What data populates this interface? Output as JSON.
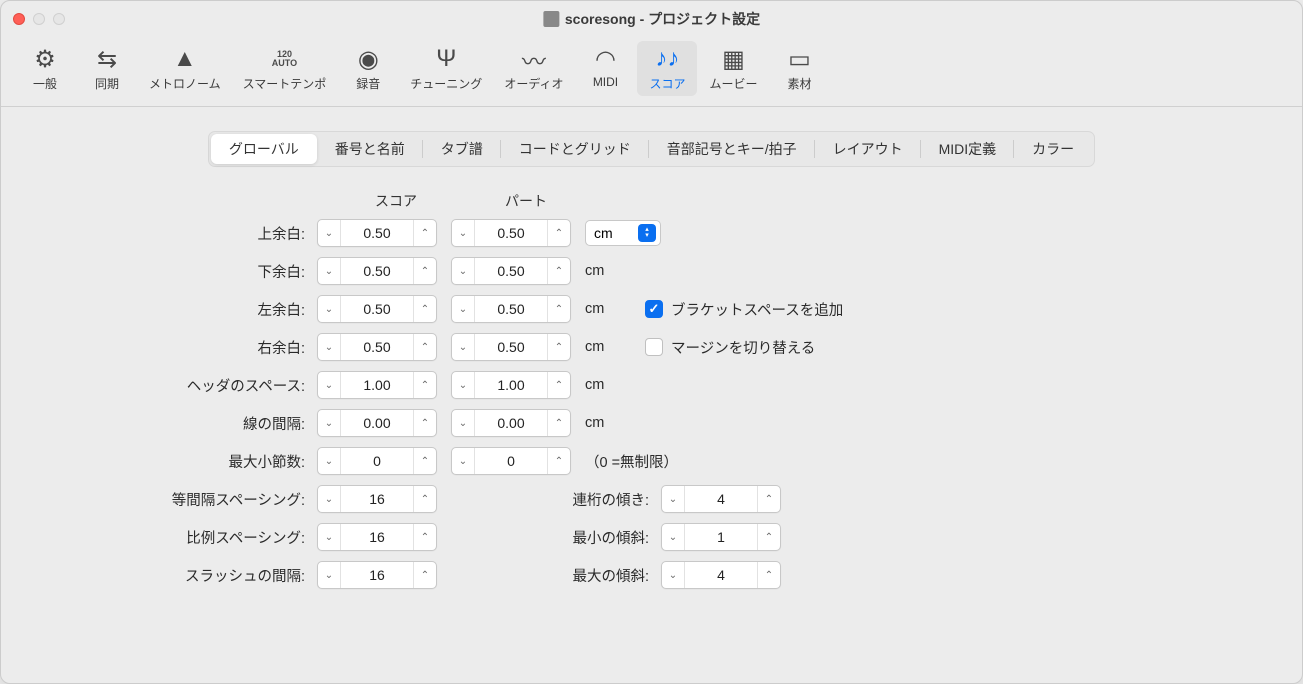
{
  "window": {
    "title": "scoresong - プロジェクト設定"
  },
  "toolbar": [
    {
      "id": "general",
      "label": "一般"
    },
    {
      "id": "sync",
      "label": "同期"
    },
    {
      "id": "metronome",
      "label": "メトロノーム"
    },
    {
      "id": "smarttempo",
      "label": "スマートテンポ"
    },
    {
      "id": "record",
      "label": "録音"
    },
    {
      "id": "tuning",
      "label": "チューニング"
    },
    {
      "id": "audio",
      "label": "オーディオ"
    },
    {
      "id": "midi",
      "label": "MIDI"
    },
    {
      "id": "score",
      "label": "スコア",
      "selected": true
    },
    {
      "id": "movie",
      "label": "ムービー"
    },
    {
      "id": "assets",
      "label": "素材"
    }
  ],
  "subtabs": [
    {
      "id": "global",
      "label": "グローバル",
      "selected": true
    },
    {
      "id": "numname",
      "label": "番号と名前"
    },
    {
      "id": "tab",
      "label": "タブ譜"
    },
    {
      "id": "chord",
      "label": "コードとグリッド"
    },
    {
      "id": "clef",
      "label": "音部記号とキー/拍子"
    },
    {
      "id": "layout",
      "label": "レイアウト"
    },
    {
      "id": "mididef",
      "label": "MIDI定義"
    },
    {
      "id": "color",
      "label": "カラー"
    }
  ],
  "headers": {
    "score": "スコア",
    "part": "パート"
  },
  "units": {
    "cm": "cm",
    "selected": "cm"
  },
  "rows": {
    "top": {
      "label": "上余白:",
      "score": "0.50",
      "part": "0.50"
    },
    "bottom": {
      "label": "下余白:",
      "score": "0.50",
      "part": "0.50"
    },
    "left": {
      "label": "左余白:",
      "score": "0.50",
      "part": "0.50"
    },
    "right": {
      "label": "右余白:",
      "score": "0.50",
      "part": "0.50"
    },
    "header": {
      "label": "ヘッダのスペース:",
      "score": "1.00",
      "part": "1.00"
    },
    "line": {
      "label": "線の間隔:",
      "score": "0.00",
      "part": "0.00"
    },
    "maxbars": {
      "label": "最大小節数:",
      "score": "0",
      "part": "0",
      "hint": "（0 =無制限）"
    }
  },
  "checks": {
    "bracket": {
      "label": "ブラケットスペースを追加",
      "checked": true
    },
    "margin": {
      "label": "マージンを切り替える",
      "checked": false
    }
  },
  "spacing": {
    "equal": {
      "label": "等間隔スペーシング:",
      "value": "16"
    },
    "prop": {
      "label": "比例スペーシング:",
      "value": "16"
    },
    "slash": {
      "label": "スラッシュの間隔:",
      "value": "16"
    },
    "beam": {
      "label": "連桁の傾き:",
      "value": "4"
    },
    "minslope": {
      "label": "最小の傾斜:",
      "value": "1"
    },
    "maxslope": {
      "label": "最大の傾斜:",
      "value": "4"
    }
  }
}
